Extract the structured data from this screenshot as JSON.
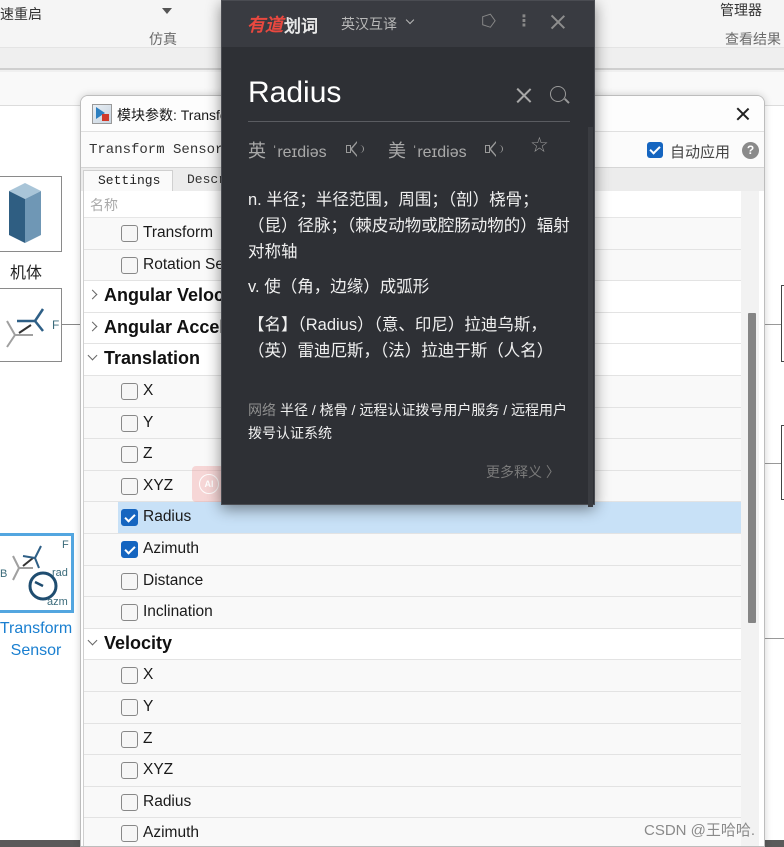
{
  "background_app": {
    "toolstrip": {
      "fast_restart_label": "速重启",
      "simulate_section": "仿真",
      "manager_label": "管理器",
      "review_results_section": "查看结果"
    },
    "canvas_blocks": [
      {
        "label": "机体",
        "icon": "solid-body-icon"
      },
      {
        "label": "",
        "icon": "frame-transform-icon",
        "port": "F"
      },
      {
        "label": "Transform Sensor",
        "icon": "transform-sensor-icon",
        "ports": [
          "B",
          "F",
          "rad",
          "azm"
        ]
      }
    ]
  },
  "dialog": {
    "title": "模块参数: Transform Sensor",
    "block_type": "Transform Sensor",
    "auto_apply_label": "自动应用",
    "auto_apply_checked": true,
    "help_icon": "question-icon",
    "tabs": [
      {
        "label": "Settings",
        "active": true
      },
      {
        "label": "Description",
        "active": false
      }
    ],
    "tree_header": "名称",
    "rows": [
      {
        "type": "item",
        "label": "Transform",
        "checked": false
      },
      {
        "type": "item",
        "label": "Rotation Sequence",
        "checked": false
      },
      {
        "type": "group",
        "label": "Angular Velocity",
        "expanded": false
      },
      {
        "type": "group",
        "label": "Angular Acceleration",
        "expanded": false
      },
      {
        "type": "group",
        "label": "Translation",
        "expanded": true
      },
      {
        "type": "item",
        "label": "X",
        "checked": false
      },
      {
        "type": "item",
        "label": "Y",
        "checked": false
      },
      {
        "type": "item",
        "label": "Z",
        "checked": false
      },
      {
        "type": "item",
        "label": "XYZ",
        "checked": false
      },
      {
        "type": "item",
        "label": "Radius",
        "checked": true,
        "selected": true
      },
      {
        "type": "item",
        "label": "Azimuth",
        "checked": true
      },
      {
        "type": "item",
        "label": "Distance",
        "checked": false
      },
      {
        "type": "item",
        "label": "Inclination",
        "checked": false
      },
      {
        "type": "group",
        "label": "Velocity",
        "expanded": true
      },
      {
        "type": "item",
        "label": "X",
        "checked": false
      },
      {
        "type": "item",
        "label": "Y",
        "checked": false
      },
      {
        "type": "item",
        "label": "Z",
        "checked": false
      },
      {
        "type": "item",
        "label": "XYZ",
        "checked": false
      },
      {
        "type": "item",
        "label": "Radius",
        "checked": false
      },
      {
        "type": "item",
        "label": "Azimuth",
        "checked": false
      }
    ],
    "ai_badge": "AI"
  },
  "dictionary_popup": {
    "brand": "有道",
    "brand_sub": "划词",
    "mode": "英汉互译",
    "word": "Radius",
    "phonetics": [
      {
        "lang": "英",
        "ipa": "ˈreɪdiəs"
      },
      {
        "lang": "美",
        "ipa": "ˈreɪdiəs"
      }
    ],
    "definitions": [
      "n. 半径；半径范围，周围；（剖）桡骨；（昆）径脉；（棘皮动物或腔肠动物的）辐射对称轴",
      "v. 使（角，边缘）成弧形",
      "【名】（Radius）（意、印尼）拉迪乌斯，（英）雷迪厄斯，（法）拉迪于斯（人名）"
    ],
    "web_tag": "网络",
    "web_meanings": "半径 / 桡骨 / 远程认证拨号用户服务 / 远程用户拨号认证系统",
    "more_label": "更多释义 〉",
    "brand_color": "#e9483f"
  },
  "watermark": "CSDN @王哈哈."
}
